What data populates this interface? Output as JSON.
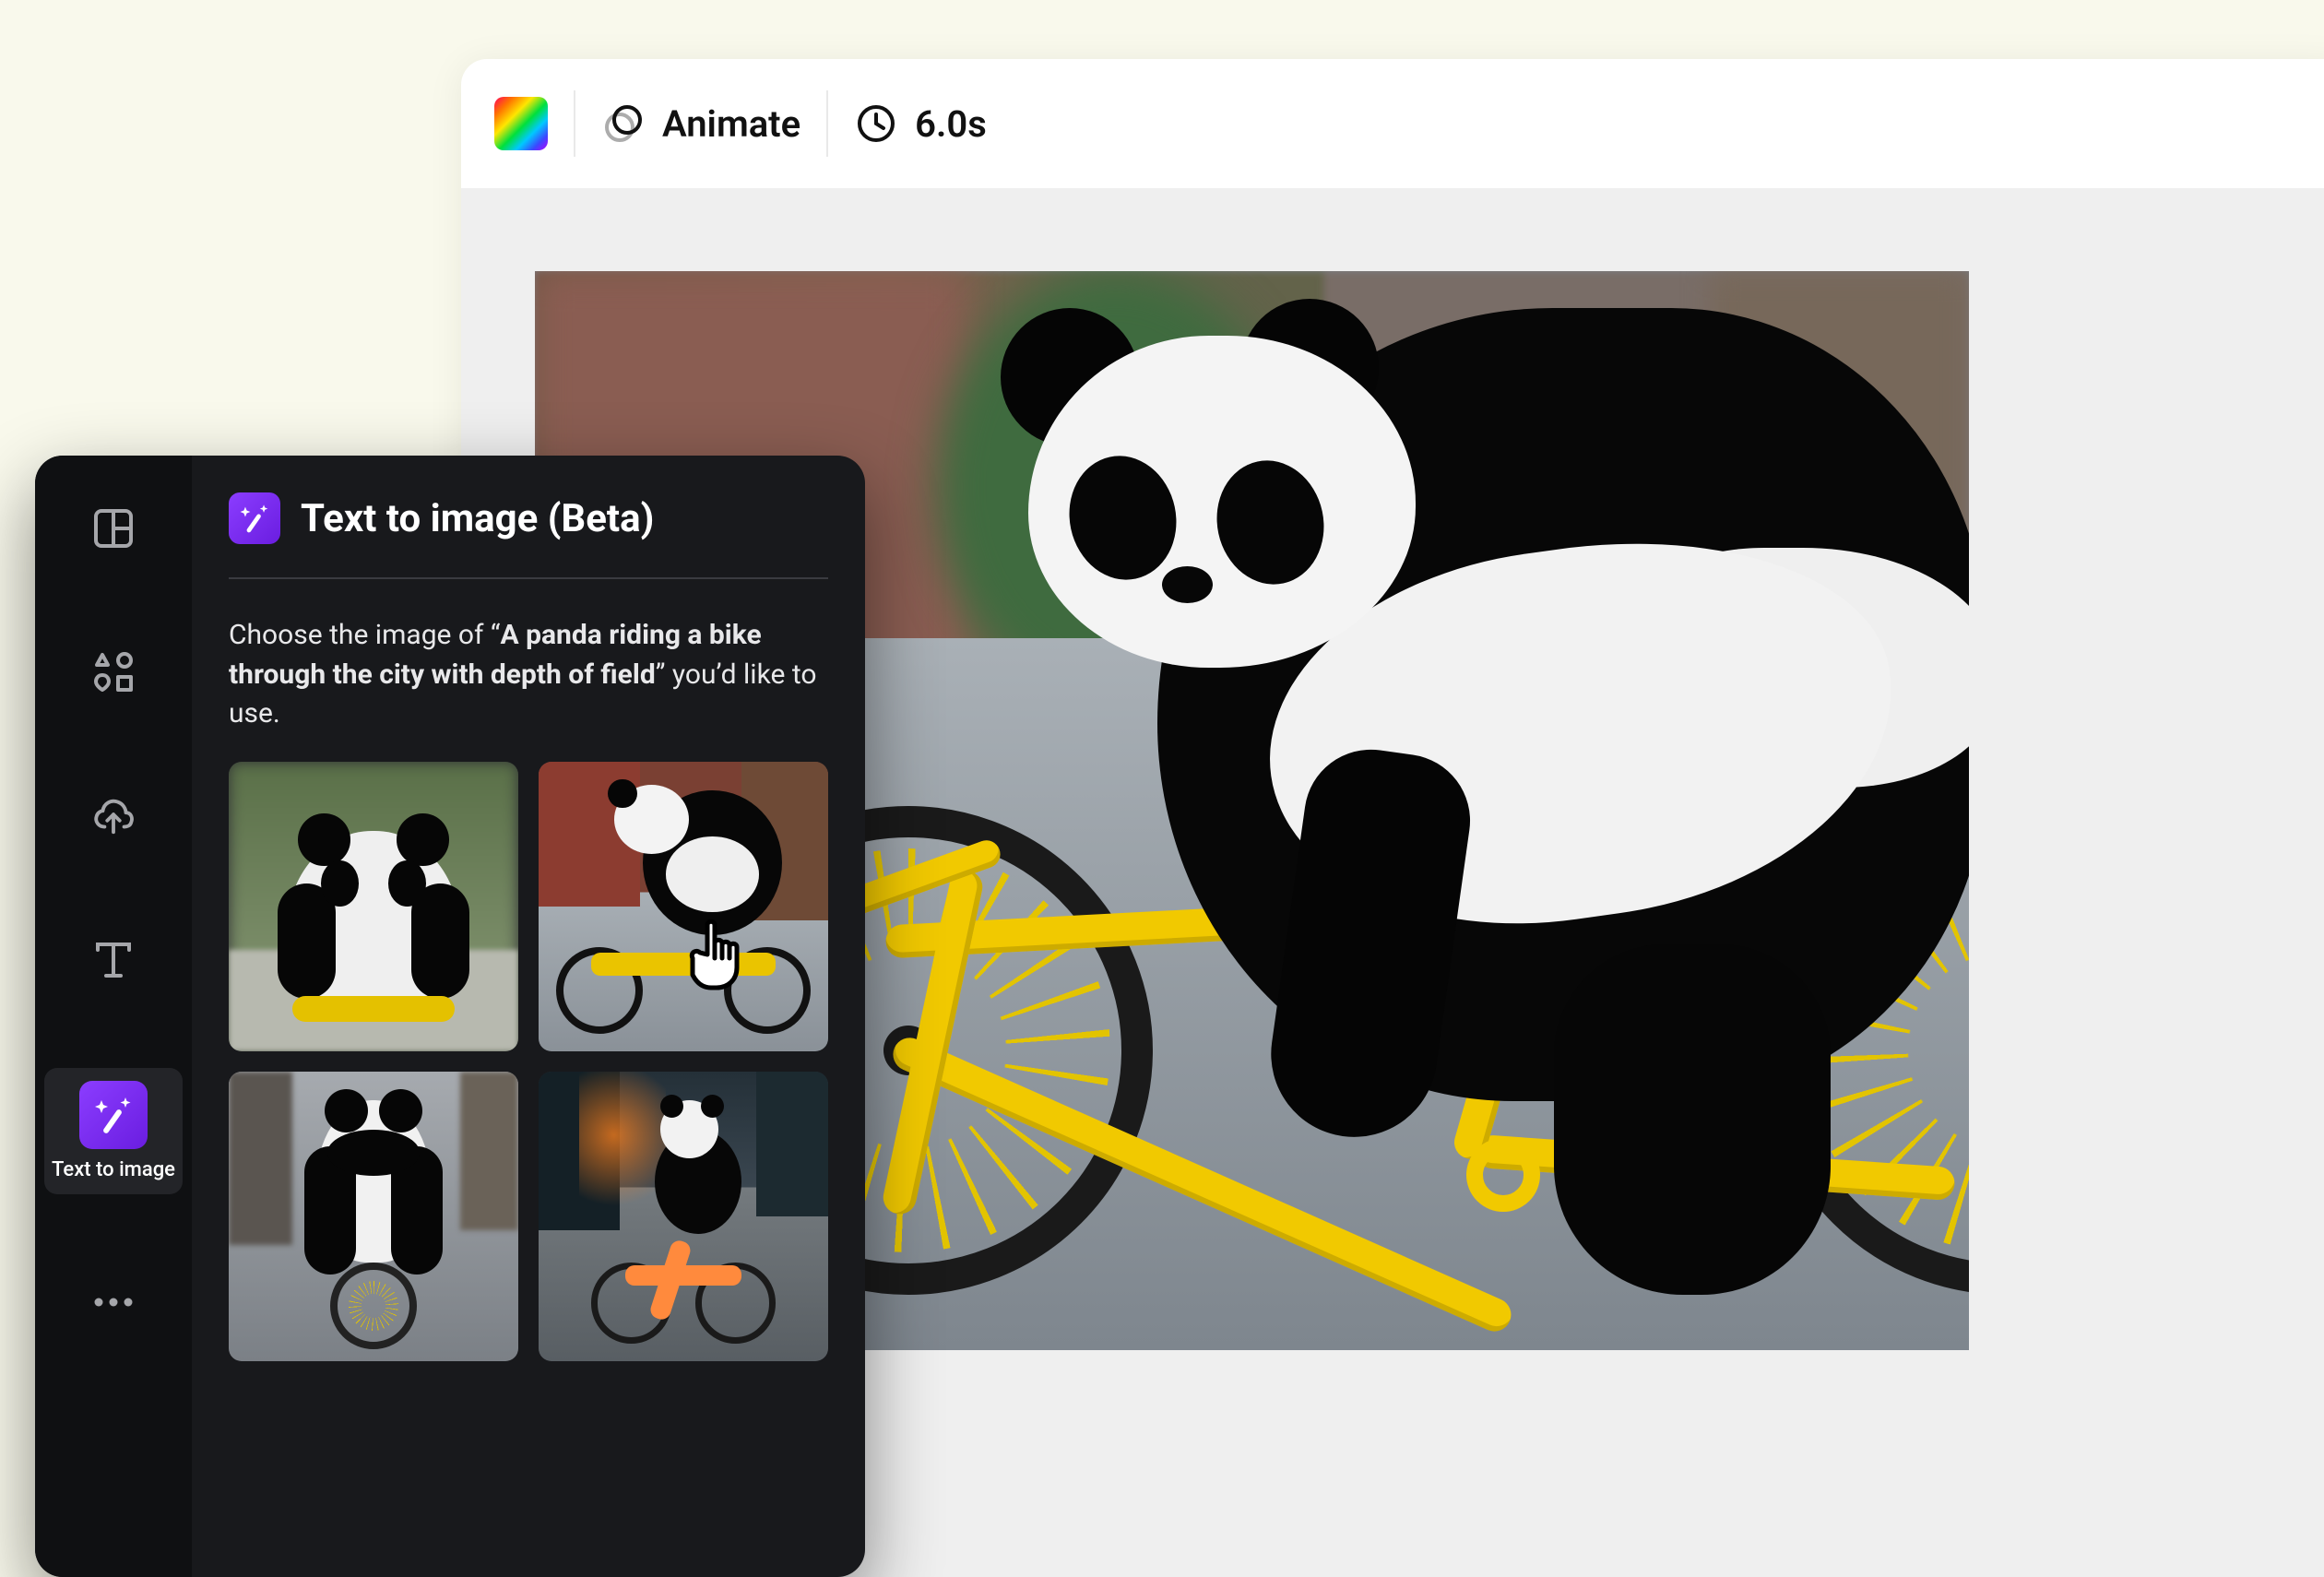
{
  "toolbar": {
    "animate_label": "Animate",
    "duration_label": "6.0s"
  },
  "sidebar": {
    "active_label": "Text to image",
    "icons": {
      "templates": "templates-icon",
      "elements": "elements-icon",
      "uploads": "uploads-icon",
      "text": "text-icon",
      "text_to_image": "magic-icon",
      "more": "more-icon"
    }
  },
  "panel": {
    "title": "Text to image (Beta)",
    "prompt_prefix": "Choose the image of “",
    "prompt_bold": "A panda riding a bike through the city with depth of field",
    "prompt_suffix": "” you’d like to use.",
    "results": [
      {
        "alt": "Panda on bike facing camera, blurred green street"
      },
      {
        "alt": "Panda riding yellow bike, red brick city street"
      },
      {
        "alt": "Panda on small bike, grey city street"
      },
      {
        "alt": "Small panda on orange bike, dusk city lights"
      }
    ]
  },
  "canvas": {
    "alt": "Large generated image of a panda riding a yellow bicycle on a city street"
  }
}
